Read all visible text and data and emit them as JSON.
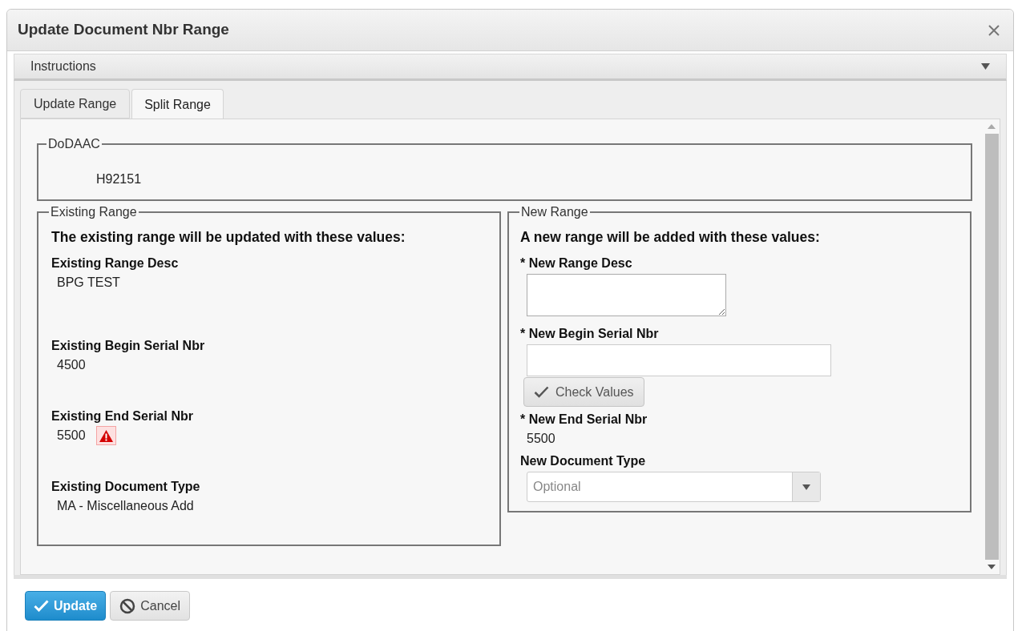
{
  "window": {
    "title": "Update Document Nbr Range"
  },
  "instructions": {
    "label": "Instructions",
    "expanded": false
  },
  "tabs": [
    {
      "label": "Update Range",
      "selected": false
    },
    {
      "label": "Split Range",
      "selected": true
    }
  ],
  "dodaac": {
    "legend": "DoDAAC",
    "value": "H92151"
  },
  "existing_range": {
    "legend": "Existing Range",
    "heading": "The existing range will be updated with these values:",
    "fields": [
      {
        "label": "Existing Range Desc",
        "value": "BPG TEST",
        "warning": false
      },
      {
        "label": "Existing Begin Serial Nbr",
        "value": "4500",
        "warning": false
      },
      {
        "label": "Existing End Serial Nbr",
        "value": "5500",
        "warning": true
      },
      {
        "label": "Existing Document Type",
        "value": "MA - Miscellaneous Add",
        "warning": false
      }
    ]
  },
  "new_range": {
    "legend": "New Range",
    "heading": "A new range will be added with these values:",
    "fields": [
      {
        "kind": "textarea",
        "label": "* New Range Desc"
      },
      {
        "kind": "input",
        "label": "* New Begin Serial Nbr"
      },
      {
        "kind": "button",
        "label": "Check Values"
      },
      {
        "kind": "readonly",
        "label": "* New End Serial Nbr",
        "value": "5500"
      },
      {
        "kind": "select",
        "label": "New Document Type",
        "placeholder": "Optional"
      }
    ]
  },
  "buttons": [
    {
      "kind": "primary",
      "label": "Update"
    },
    {
      "kind": "cancel",
      "label": "Cancel"
    }
  ]
}
